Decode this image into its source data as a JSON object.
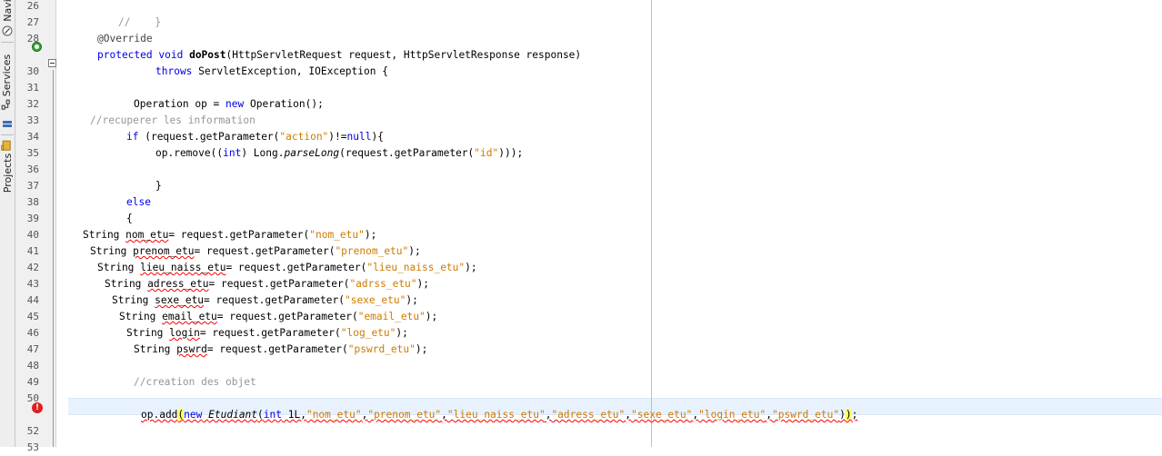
{
  "sidebar": {
    "tabs": [
      {
        "label": "Navi",
        "icon": "navigator-icon"
      },
      {
        "label": "Services",
        "icon": "services-icon"
      },
      {
        "label": "Projects",
        "icon": "projects-icon"
      }
    ]
  },
  "editor": {
    "lines": [
      {
        "n": "26",
        "indent": 0,
        "tokens": []
      },
      {
        "n": "27",
        "indent": 130,
        "tokens": [
          {
            "t": "//    }",
            "c": "cmt"
          }
        ]
      },
      {
        "n": "28",
        "indent": 107,
        "tokens": [
          {
            "t": "@Override",
            "c": "ann"
          }
        ]
      },
      {
        "n": "",
        "indent": 107,
        "tokens": [
          {
            "t": "protected",
            "c": "kw"
          },
          {
            "t": " "
          },
          {
            "t": "void",
            "c": "kw"
          },
          {
            "t": " "
          },
          {
            "t": "doPost",
            "c": "bold"
          },
          {
            "t": "(HttpServletRequest request, HttpServletResponse response)"
          }
        ]
      },
      {
        "n": "30",
        "indent": 171,
        "tokens": [
          {
            "t": "throws",
            "c": "kw"
          },
          {
            "t": " ServletException, IOException {"
          }
        ]
      },
      {
        "n": "31",
        "indent": 0,
        "tokens": []
      },
      {
        "n": "32",
        "indent": 147,
        "tokens": [
          {
            "t": "Operation op = "
          },
          {
            "t": "new",
            "c": "kw"
          },
          {
            "t": " Operation();"
          }
        ]
      },
      {
        "n": "33",
        "indent": 99,
        "tokens": [
          {
            "t": "//recuperer les information",
            "c": "cmt"
          }
        ]
      },
      {
        "n": "34",
        "indent": 139,
        "tokens": [
          {
            "t": "if",
            "c": "kw"
          },
          {
            "t": " (request.getParameter("
          },
          {
            "t": "\"action\"",
            "c": "str"
          },
          {
            "t": ")!="
          },
          {
            "t": "null",
            "c": "kw"
          },
          {
            "t": "){"
          }
        ]
      },
      {
        "n": "35",
        "indent": 171,
        "tokens": [
          {
            "t": "op.remove(("
          },
          {
            "t": "int",
            "c": "kw"
          },
          {
            "t": ") Long."
          },
          {
            "t": "parseLong",
            "c": "it"
          },
          {
            "t": "(request.getParameter("
          },
          {
            "t": "\"id\"",
            "c": "str"
          },
          {
            "t": ")));"
          }
        ]
      },
      {
        "n": "36",
        "indent": 0,
        "tokens": []
      },
      {
        "n": "37",
        "indent": 171,
        "tokens": [
          {
            "t": "}"
          }
        ]
      },
      {
        "n": "38",
        "indent": 139,
        "tokens": [
          {
            "t": "else",
            "c": "kw"
          }
        ]
      },
      {
        "n": "39",
        "indent": 139,
        "tokens": [
          {
            "t": "{"
          }
        ]
      },
      {
        "n": "40",
        "indent": 91,
        "tokens": [
          {
            "t": "String "
          },
          {
            "t": "nom_etu",
            "c": "err"
          },
          {
            "t": "= request.getParameter("
          },
          {
            "t": "\"nom_etu\"",
            "c": "str"
          },
          {
            "t": ");"
          }
        ]
      },
      {
        "n": "41",
        "indent": 99,
        "tokens": [
          {
            "t": "String "
          },
          {
            "t": "prenom_etu",
            "c": "err"
          },
          {
            "t": "= request.getParameter("
          },
          {
            "t": "\"prenom_etu\"",
            "c": "str"
          },
          {
            "t": ");"
          }
        ]
      },
      {
        "n": "42",
        "indent": 107,
        "tokens": [
          {
            "t": "String "
          },
          {
            "t": "lieu_naiss_etu",
            "c": "err"
          },
          {
            "t": "= request.getParameter("
          },
          {
            "t": "\"lieu_naiss_etu\"",
            "c": "str"
          },
          {
            "t": ");"
          }
        ]
      },
      {
        "n": "43",
        "indent": 115,
        "tokens": [
          {
            "t": "String "
          },
          {
            "t": "adress_etu",
            "c": "err"
          },
          {
            "t": "= request.getParameter("
          },
          {
            "t": "\"adrss_etu\"",
            "c": "str"
          },
          {
            "t": ");"
          }
        ]
      },
      {
        "n": "44",
        "indent": 123,
        "tokens": [
          {
            "t": "String "
          },
          {
            "t": "sexe_etu",
            "c": "err"
          },
          {
            "t": "= request.getParameter("
          },
          {
            "t": "\"sexe_etu\"",
            "c": "str"
          },
          {
            "t": ");"
          }
        ]
      },
      {
        "n": "45",
        "indent": 131,
        "tokens": [
          {
            "t": "String "
          },
          {
            "t": "email_etu",
            "c": "err"
          },
          {
            "t": "= request.getParameter("
          },
          {
            "t": "\"email_etu\"",
            "c": "str"
          },
          {
            "t": ");"
          }
        ]
      },
      {
        "n": "46",
        "indent": 139,
        "tokens": [
          {
            "t": "String "
          },
          {
            "t": "login",
            "c": "err"
          },
          {
            "t": "= request.getParameter("
          },
          {
            "t": "\"log_etu\"",
            "c": "str"
          },
          {
            "t": ");"
          }
        ]
      },
      {
        "n": "47",
        "indent": 147,
        "tokens": [
          {
            "t": "String "
          },
          {
            "t": "pswrd",
            "c": "err"
          },
          {
            "t": "= request.getParameter("
          },
          {
            "t": "\"pswrd_etu\"",
            "c": "str"
          },
          {
            "t": ");"
          }
        ]
      },
      {
        "n": "48",
        "indent": 0,
        "tokens": []
      },
      {
        "n": "49",
        "indent": 147,
        "tokens": [
          {
            "t": "//creation des objet",
            "c": "cmt"
          }
        ]
      },
      {
        "n": "50",
        "indent": 0,
        "tokens": []
      },
      {
        "n": "",
        "indent": 155,
        "tokens": [
          {
            "t": "op.add",
            "c": "err"
          },
          {
            "t": "(",
            "c": "caret-hl err"
          },
          {
            "t": "new",
            "c": "kw err"
          },
          {
            "t": " ",
            "c": "err"
          },
          {
            "t": "Etudiant",
            "c": "it err"
          },
          {
            "t": "(",
            "c": "err"
          },
          {
            "t": "int",
            "c": "kw err"
          },
          {
            "t": " 1L,",
            "c": "err"
          },
          {
            "t": "\"nom_etu\"",
            "c": "str err"
          },
          {
            "t": ",",
            "c": "err"
          },
          {
            "t": "\"prenom_etu\"",
            "c": "str err"
          },
          {
            "t": ",",
            "c": "err"
          },
          {
            "t": "\"lieu_naiss_etu\"",
            "c": "str err"
          },
          {
            "t": ",",
            "c": "err"
          },
          {
            "t": "\"adress_etu\"",
            "c": "str err"
          },
          {
            "t": ",",
            "c": "err"
          },
          {
            "t": "\"sexe_etu\"",
            "c": "str err"
          },
          {
            "t": ",",
            "c": "err"
          },
          {
            "t": "\"login_etu\"",
            "c": "str err"
          },
          {
            "t": ",",
            "c": "err"
          },
          {
            "t": "\"pswrd_etu\"",
            "c": "str err"
          },
          {
            "t": ")",
            "c": "err"
          },
          {
            "t": ")",
            "c": "caret-hl err"
          },
          {
            "t": ";",
            "c": "err"
          }
        ]
      },
      {
        "n": "52",
        "indent": 0,
        "tokens": []
      },
      {
        "n": "53",
        "indent": 0,
        "tokens": []
      }
    ]
  }
}
